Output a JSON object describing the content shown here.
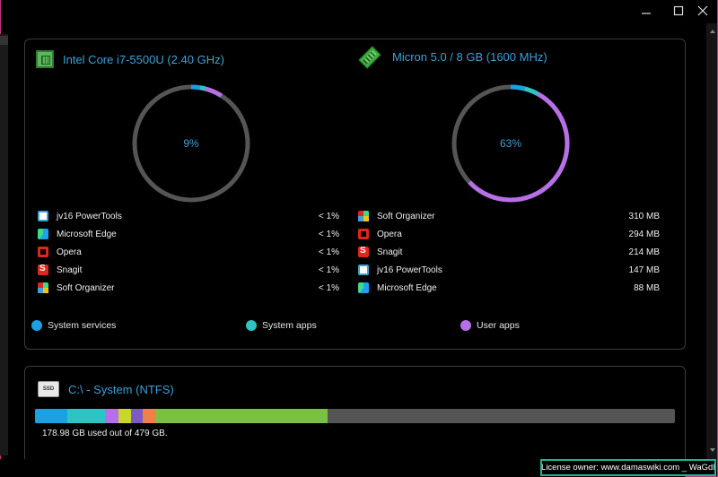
{
  "window": {
    "minimize_icon": "minimize-icon",
    "maximize_icon": "maximize-icon",
    "close_icon": "close-icon"
  },
  "cpu": {
    "title": "Intel Core i7-5500U (2.40 GHz)",
    "usage_label": "9%",
    "usage_value": 9,
    "segments": [
      {
        "name": "System services",
        "value": 2.5,
        "color": "#1ba1e2"
      },
      {
        "name": "System apps",
        "value": 1.5,
        "color": "#2ec4c4"
      },
      {
        "name": "User apps",
        "value": 5.0,
        "color": "#b76fe8"
      }
    ],
    "processes": [
      {
        "name": "jv16 PowerTools",
        "value": "< 1%",
        "icon": "jv16-icon"
      },
      {
        "name": "Microsoft Edge",
        "value": "< 1%",
        "icon": "edge-icon"
      },
      {
        "name": "Opera",
        "value": "< 1%",
        "icon": "opera-icon"
      },
      {
        "name": "Snagit",
        "value": "< 1%",
        "icon": "snagit-icon"
      },
      {
        "name": "Soft Organizer",
        "value": "< 1%",
        "icon": "soft-organizer-icon"
      }
    ]
  },
  "ram": {
    "title": "Micron 5.0 / 8 GB (1600 MHz)",
    "usage_label": "63%",
    "usage_value": 63,
    "segments": [
      {
        "name": "System services",
        "value": 4,
        "color": "#1ba1e2"
      },
      {
        "name": "System apps",
        "value": 4,
        "color": "#2ec4c4"
      },
      {
        "name": "User apps",
        "value": 55,
        "color": "#b76fe8"
      }
    ],
    "processes": [
      {
        "name": "Soft Organizer",
        "value": "310 MB",
        "icon": "soft-organizer-icon"
      },
      {
        "name": "Opera",
        "value": "294 MB",
        "icon": "opera-icon"
      },
      {
        "name": "Snagit",
        "value": "214 MB",
        "icon": "snagit-icon"
      },
      {
        "name": "jv16 PowerTools",
        "value": "147 MB",
        "icon": "jv16-icon"
      },
      {
        "name": "Microsoft Edge",
        "value": "88 MB",
        "icon": "edge-icon"
      }
    ]
  },
  "legend": [
    {
      "label": "System services",
      "color": "#1ba1e2"
    },
    {
      "label": "System apps",
      "color": "#2ec4c4"
    },
    {
      "label": "User apps",
      "color": "#b76fe8"
    }
  ],
  "disk": {
    "title": "C:\\ - System (NTFS)",
    "icon_text": "SSD",
    "used_text": "178.98 GB used out of 479 GB.",
    "used_fraction": 0.3737,
    "segments": [
      {
        "value": 0.05,
        "color": "#1ba1e2"
      },
      {
        "value": 0.06,
        "color": "#2ec4c4"
      },
      {
        "value": 0.02,
        "color": "#b76fe8"
      },
      {
        "value": 0.02,
        "color": "#c8d82a"
      },
      {
        "value": 0.018,
        "color": "#7a5cc8"
      },
      {
        "value": 0.02,
        "color": "#f07f4a"
      },
      {
        "value": 0.27,
        "color": "#79c043"
      }
    ]
  },
  "license": {
    "text": "License owner: www.damaswiki.com _ WaGdI"
  }
}
